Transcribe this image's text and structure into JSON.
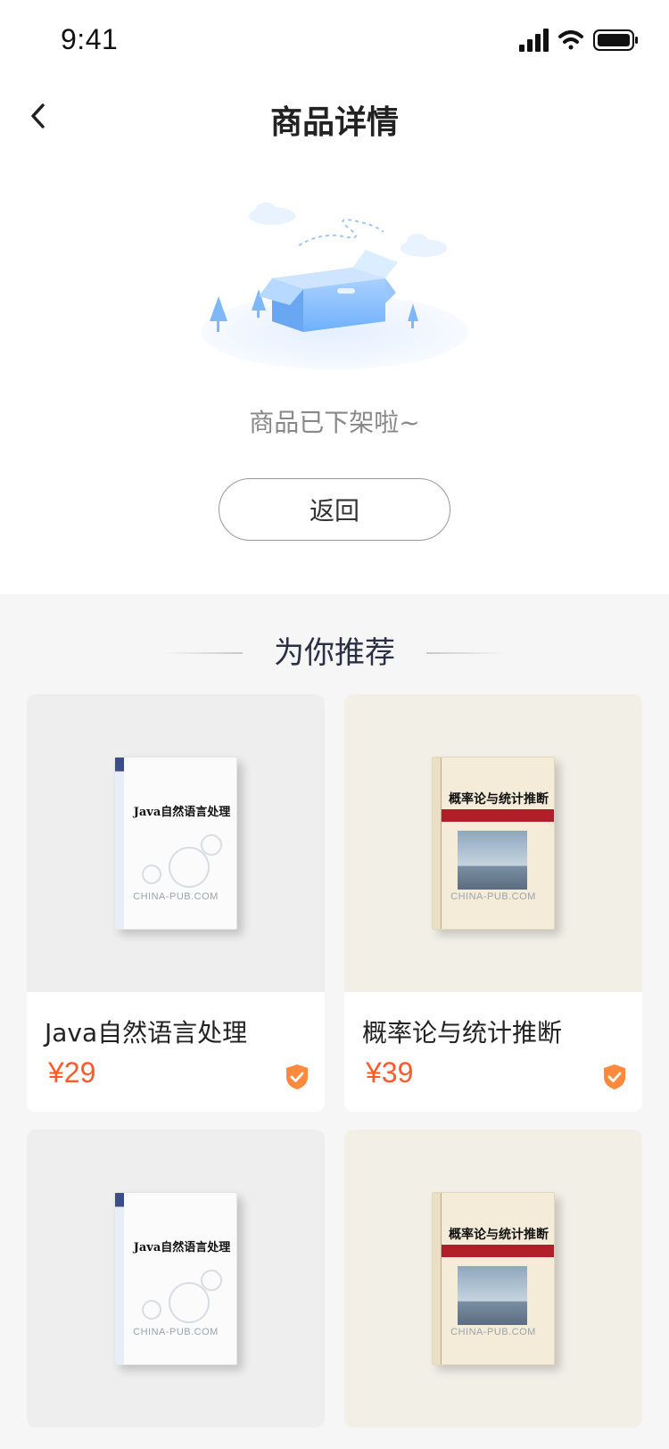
{
  "status_bar": {
    "time": "9:41"
  },
  "nav": {
    "title": "商品详情"
  },
  "empty_state": {
    "message": "商品已下架啦~",
    "return_button": "返回"
  },
  "recommend": {
    "title": "为你推荐",
    "items": [
      {
        "title": "Java自然语言处理",
        "price": "¥29",
        "cover": "Java自然语言处理",
        "cover_bg": "#eeeeee"
      },
      {
        "title": "概率论与统计推断",
        "price": "¥39",
        "cover": "概率论与统计推断",
        "cover_bg": "#f2efe7"
      },
      {
        "title": "",
        "price": "",
        "cover": "Java自然语言处理",
        "cover_bg": "#eeeeee"
      },
      {
        "title": "",
        "price": "",
        "cover": "概率论与统计推断",
        "cover_bg": "#f2efe7"
      }
    ]
  },
  "colors": {
    "price": "#ff5a2c",
    "badge": "#ff8a3d",
    "section_bg": "#f6f6f6"
  }
}
